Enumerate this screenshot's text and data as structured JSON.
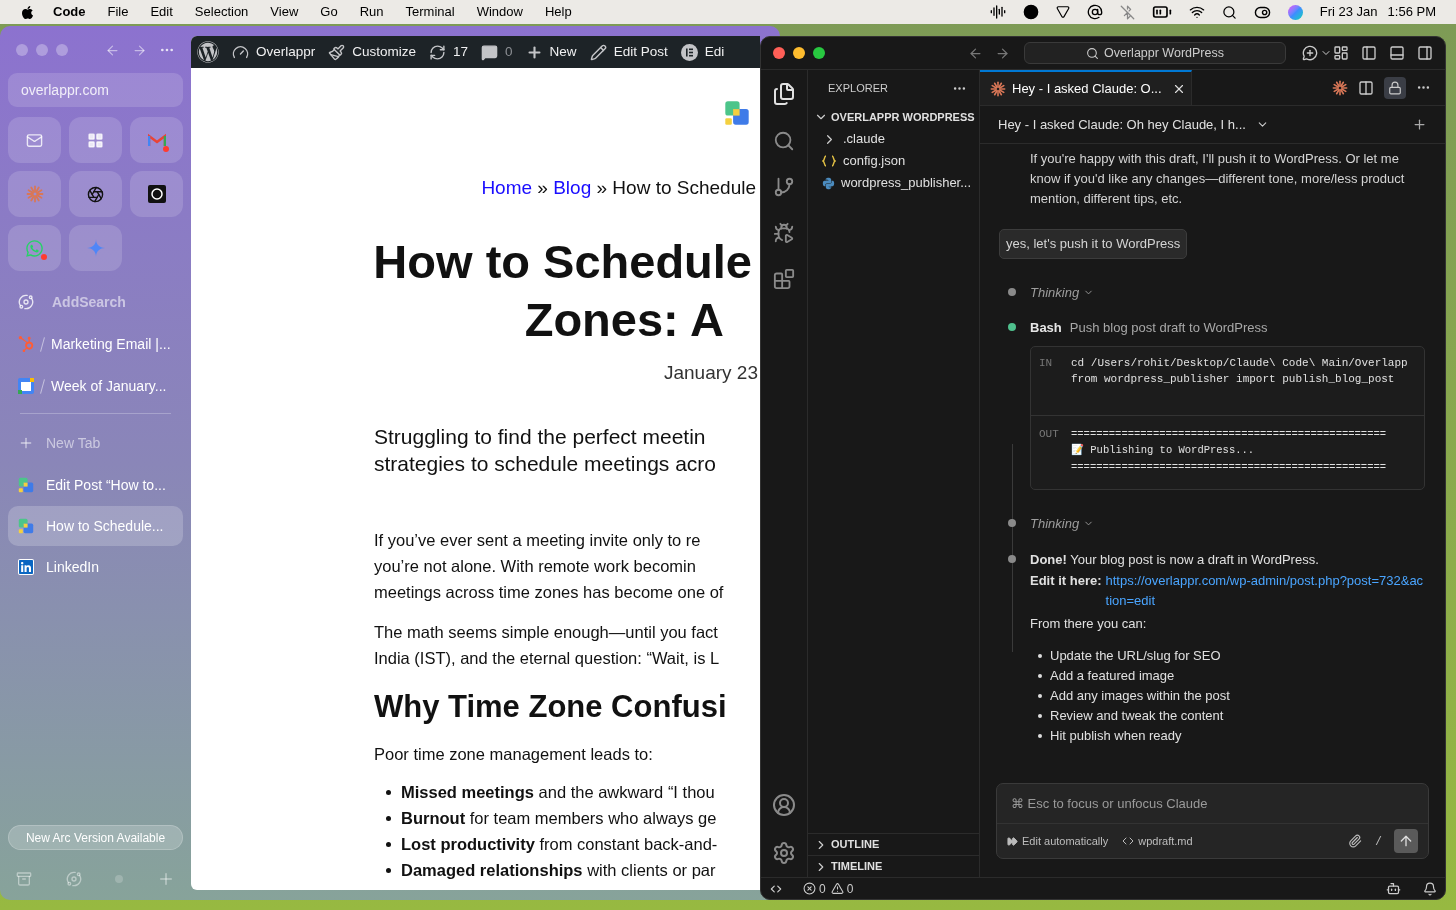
{
  "menubar": {
    "app": "Code",
    "menus": [
      "File",
      "Edit",
      "Selection",
      "View",
      "Go",
      "Run",
      "Terminal",
      "Window",
      "Help"
    ],
    "date": "Fri 23 Jan",
    "time": "1:56 PM"
  },
  "browser": {
    "url": "overlappr.com",
    "pinned": [
      {
        "kind": "mail",
        "unread": false
      },
      {
        "kind": "grid",
        "unread": false
      },
      {
        "kind": "gmail",
        "unread": true
      },
      {
        "kind": "claude",
        "unread": false
      },
      {
        "kind": "openai",
        "unread": false
      },
      {
        "kind": "dark-app",
        "unread": false
      },
      {
        "kind": "whatsapp",
        "unread": true
      },
      {
        "kind": "gemini",
        "unread": false
      }
    ],
    "saved": [
      {
        "kind": "folder",
        "label": "AddSearch"
      },
      {
        "kind": "hubspot",
        "label": "Marketing Email |..."
      },
      {
        "kind": "calendar",
        "label": "Week of January..."
      }
    ],
    "new_tab": "New Tab",
    "tabs": [
      {
        "kind": "overlappr",
        "label": "Edit Post “How to...",
        "selected": false
      },
      {
        "kind": "overlappr",
        "label": "How to Schedule...",
        "selected": true
      },
      {
        "kind": "linkedin",
        "label": "LinkedIn",
        "selected": false
      }
    ],
    "update_banner": "New Arc Version Available"
  },
  "admin_bar": [
    {
      "kind": "wordpress"
    },
    {
      "kind": "site",
      "label": "Overlappr"
    },
    {
      "kind": "customize",
      "label": "Customize"
    },
    {
      "kind": "updates",
      "label": "17"
    },
    {
      "kind": "comments",
      "label": "0"
    },
    {
      "kind": "new",
      "label": "New"
    },
    {
      "kind": "edit",
      "label": "Edit Post"
    },
    {
      "kind": "elementor",
      "label": "Edi"
    }
  ],
  "page": {
    "breadcrumb": [
      {
        "kind": "link",
        "text": "Home"
      },
      {
        "kind": "sep",
        "text": "»"
      },
      {
        "kind": "link",
        "text": "Blog"
      },
      {
        "kind": "sep",
        "text": "»"
      },
      {
        "kind": "current",
        "text": "How to Schedule"
      }
    ],
    "title_lines": [
      "How to Schedule",
      "Zones: A"
    ],
    "date": "January 23",
    "intro_lines": [
      "Struggling to find the perfect meetin",
      "strategies to schedule meetings acro"
    ],
    "paragraphs": [
      [
        "If you’ve ever sent a meeting invite only to re",
        "you’re not alone. With remote work becomin",
        "meetings across time zones has become one of"
      ],
      [
        "The math seems simple enough—until you fact",
        "India (IST), and the eternal question: “Wait, is L"
      ]
    ],
    "heading": "Why Time Zone Confusi",
    "lead": "Poor time zone management leads to:",
    "bullets": [
      "**Missed meetings** and the awkward “I thou",
      "**Burnout** for team members who always ge",
      "**Lost productivity** from constant back-and-",
      "**Damaged relationships** with clients or par"
    ]
  },
  "editor": {
    "search": "Overlappr WordPress",
    "explorer": {
      "title": "EXPLORER",
      "folder": "OVERLAPPR WORDPRESS",
      "expanded": true,
      "files": [
        {
          "kind": "folder",
          "name": ".claude",
          "expanded": false
        },
        {
          "kind": "json",
          "name": "config.json"
        },
        {
          "kind": "python",
          "name": "wordpress_publisher..."
        }
      ],
      "sections": [
        {
          "label": "OUTLINE",
          "expanded": false
        },
        {
          "label": "TIMELINE",
          "expanded": false
        }
      ]
    },
    "tab": "Hey - I asked Claude: O...",
    "session_title": "Hey - I asked Claude: Oh hey Claude, I h...",
    "chat": [
      {
        "kind": "text",
        "text": "If you're happy with this draft, I'll push it to WordPress. Or let me know if you'd like any changes—different tone, more/less product mention, different tips, etc."
      },
      {
        "kind": "user",
        "text": "yes, let's push it to WordPress"
      },
      {
        "kind": "thinking",
        "label": "Thinking",
        "color": "#8a8a8a"
      },
      {
        "kind": "tool",
        "tool": "Bash",
        "description": "Push blog post draft to WordPress",
        "color": "#4fc08d",
        "in_label": "IN",
        "in": [
          "cd /Users/rohit/Desktop/Claude\\ Code\\ Main/Overlapp",
          "from wordpress_publisher import publish_blog_post"
        ],
        "out_label": "OUT",
        "out": [
          "==================================================",
          "📝 Publishing to WordPress...",
          "=================================================="
        ]
      },
      {
        "kind": "thinking",
        "label": "Thinking",
        "color": "#8a8a8a"
      },
      {
        "kind": "result",
        "color": "#8a8a8a",
        "text": "**Done!** Your blog post is now a draft in WordPress.",
        "link_label": "Edit it here:",
        "link": "https://overlappr.com/wp-admin/post.php?post=732&action=edit",
        "after": "From there you can:",
        "bullets": [
          "Update the URL/slug for SEO",
          "Add a featured image",
          "Add any images within the post",
          "Review and tweak the content",
          "Hit publish when ready"
        ]
      }
    ],
    "input": {
      "placeholder": "⌘ Esc to focus or unfocus Claude",
      "mode": "Edit automatically",
      "file": "wpdraft.md",
      "slash": "/"
    },
    "status": {
      "errors": "0",
      "warnings": "0"
    }
  }
}
